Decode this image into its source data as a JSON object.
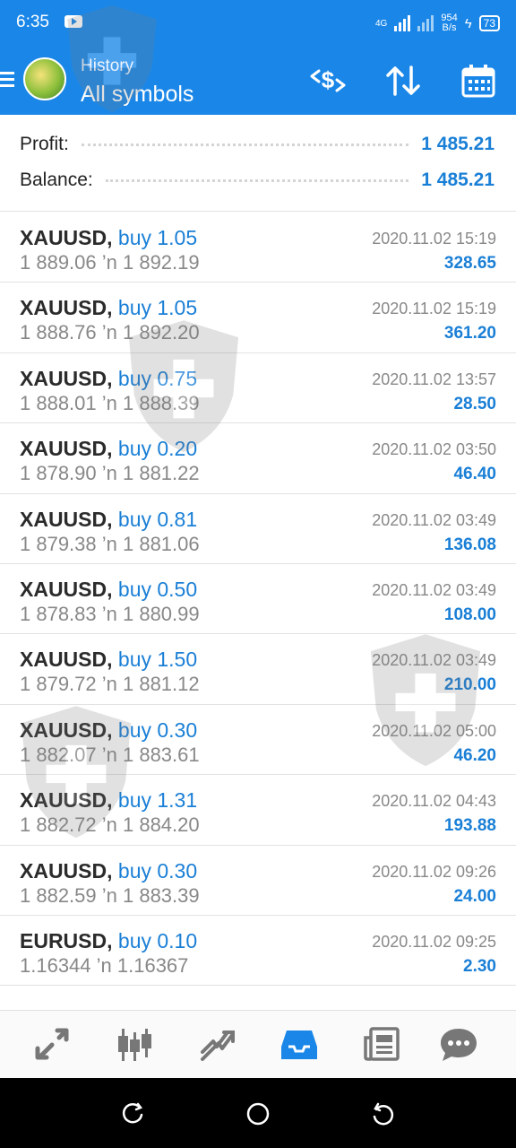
{
  "status_bar": {
    "time": "6:35",
    "network": "4G",
    "speed_value": "954",
    "speed_unit": "B/s",
    "battery": "73"
  },
  "header": {
    "title_small": "History",
    "title": "All symbols",
    "icons": [
      "currency-exchange-icon",
      "sort-icon",
      "calendar-icon"
    ]
  },
  "summary": {
    "profit_label": "Profit:",
    "profit_value": "1 485.21",
    "balance_label": "Balance:",
    "balance_value": "1 485.21"
  },
  "trades": [
    {
      "symbol": "XAUUSD,",
      "side": "buy 1.05",
      "time": "2020.11.02 15:19",
      "prices": "1 889.06 ’n  1 892.19",
      "profit": "328.65"
    },
    {
      "symbol": "XAUUSD,",
      "side": "buy 1.05",
      "time": "2020.11.02 15:19",
      "prices": "1 888.76 ’n  1 892.20",
      "profit": "361.20"
    },
    {
      "symbol": "XAUUSD,",
      "side": "buy 0.75",
      "time": "2020.11.02 13:57",
      "prices": "1 888.01 ’n  1 888.39",
      "profit": "28.50"
    },
    {
      "symbol": "XAUUSD,",
      "side": "buy 0.20",
      "time": "2020.11.02 03:50",
      "prices": "1 878.90 ’n  1 881.22",
      "profit": "46.40"
    },
    {
      "symbol": "XAUUSD,",
      "side": "buy 0.81",
      "time": "2020.11.02 03:49",
      "prices": "1 879.38 ’n  1 881.06",
      "profit": "136.08"
    },
    {
      "symbol": "XAUUSD,",
      "side": "buy 0.50",
      "time": "2020.11.02 03:49",
      "prices": "1 878.83 ’n  1 880.99",
      "profit": "108.00"
    },
    {
      "symbol": "XAUUSD,",
      "side": "buy 1.50",
      "time": "2020.11.02 03:49",
      "prices": "1 879.72 ’n  1 881.12",
      "profit": "210.00"
    },
    {
      "symbol": "XAUUSD,",
      "side": "buy 0.30",
      "time": "2020.11.02 05:00",
      "prices": "1 882.07 ’n  1 883.61",
      "profit": "46.20"
    },
    {
      "symbol": "XAUUSD,",
      "side": "buy 1.31",
      "time": "2020.11.02 04:43",
      "prices": "1 882.72 ’n  1 884.20",
      "profit": "193.88"
    },
    {
      "symbol": "XAUUSD,",
      "side": "buy 0.30",
      "time": "2020.11.02 09:26",
      "prices": "1 882.59 ’n  1 883.39",
      "profit": "24.00"
    },
    {
      "symbol": "EURUSD,",
      "side": "buy 0.10",
      "time": "2020.11.02 09:25",
      "prices": "1.16344 ’n  1.16367",
      "profit": "2.30"
    }
  ],
  "bottom_nav": [
    "quotes-icon",
    "chart-icon",
    "trade-icon",
    "history-icon",
    "news-icon",
    "chat-icon"
  ],
  "active_tab": "history-icon",
  "colors": {
    "accent": "#1a87e8",
    "profit": "#1a7fd6",
    "muted": "#888888"
  }
}
